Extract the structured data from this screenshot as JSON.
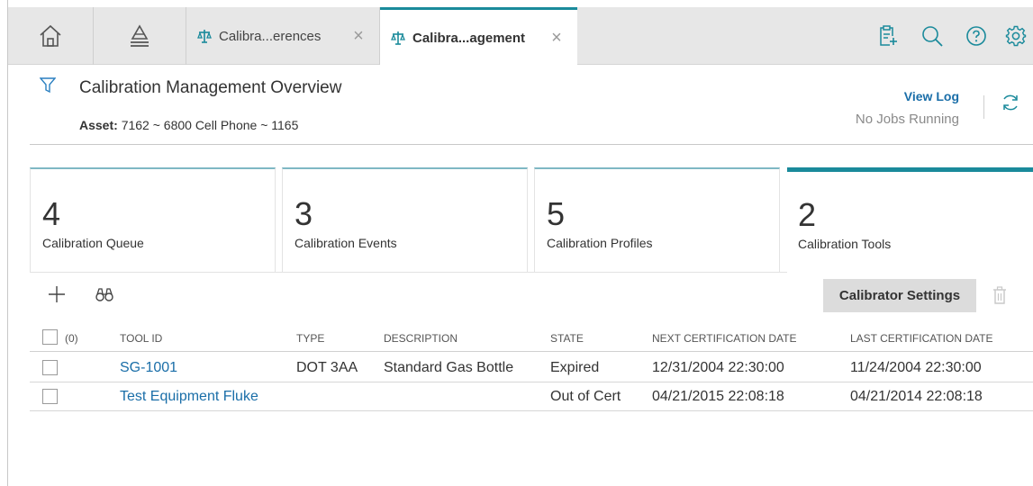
{
  "tabs": [
    {
      "label": "Calibra...erences",
      "active": false
    },
    {
      "label": "Calibra...agement",
      "active": true
    }
  ],
  "toolbar_icons": [
    "home-icon",
    "asset-hierarchy-icon",
    "new-document-icon",
    "search-icon",
    "help-icon",
    "settings-icon"
  ],
  "header": {
    "title": "Calibration Management Overview",
    "asset_label": "Asset:",
    "asset_value": "7162 ~ 6800 Cell Phone ~ 1165",
    "view_log": "View Log",
    "jobs_status": "No Jobs Running"
  },
  "cards": [
    {
      "count": "4",
      "label": "Calibration Queue"
    },
    {
      "count": "3",
      "label": "Calibration Events"
    },
    {
      "count": "5",
      "label": "Calibration Profiles"
    },
    {
      "count": "2",
      "label": "Calibration Tools",
      "active": true
    }
  ],
  "actions": {
    "add": "+",
    "calibrator_settings": "Calibrator Settings"
  },
  "table": {
    "selected_count": "(0)",
    "columns": [
      "TOOL ID",
      "TYPE",
      "DESCRIPTION",
      "STATE",
      "NEXT CERTIFICATION DATE",
      "LAST CERTIFICATION DATE"
    ],
    "rows": [
      {
        "tool_id": "SG-1001",
        "type": "DOT 3AA",
        "description": "Standard Gas Bottle",
        "state": "Expired",
        "next_cert": "12/31/2004 22:30:00",
        "last_cert": "11/24/2004 22:30:00"
      },
      {
        "tool_id": "Test Equipment Fluke",
        "type": "",
        "description": "",
        "state": "Out of Cert",
        "next_cert": "04/21/2015 22:08:18",
        "last_cert": "04/21/2014 22:08:18"
      }
    ]
  },
  "colors": {
    "accent": "#1a8a9b",
    "link": "#1a6ea8",
    "tabbar_bg": "#e7e7e7"
  }
}
